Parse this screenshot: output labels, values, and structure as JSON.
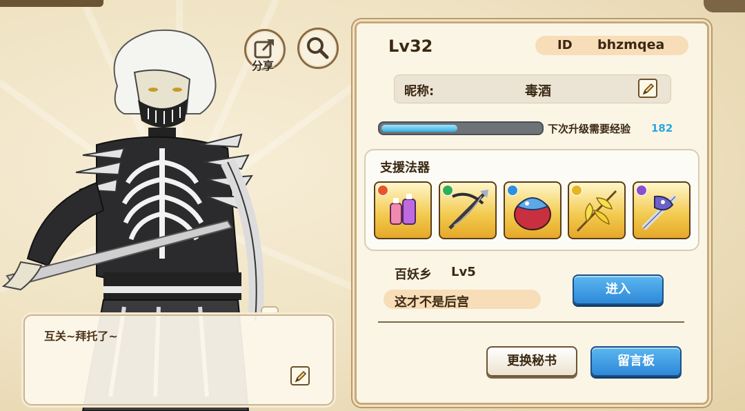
{
  "profile": {
    "level": "Lv32",
    "id_label": "ID",
    "id_value": "bhzmqea",
    "nickname_label": "昵称:",
    "nickname": "毒酒",
    "exp_label": "下次升级需要经验",
    "exp_value": "182",
    "exp_progress": 0.48
  },
  "support": {
    "title": "支援法器",
    "items": [
      {
        "name": "perfume-bottles-artifact",
        "element_color": "#e8552a"
      },
      {
        "name": "crossbow-artifact",
        "element_color": "#2fae5a"
      },
      {
        "name": "shark-shield-artifact",
        "element_color": "#2f8fe0"
      },
      {
        "name": "golden-feather-spear-artifact",
        "element_color": "#e8b420"
      },
      {
        "name": "dragon-sword-artifact",
        "element_color": "#8a4fd0"
      }
    ]
  },
  "guild": {
    "name": "百妖乡",
    "level": "Lv5",
    "motto": "这才不是后宫",
    "enter_label": "进入"
  },
  "buttons": {
    "share_label": "分享",
    "swap_secretary": "更换秘书",
    "message_board": "留言板"
  },
  "quote": {
    "text": "互关~拜托了~"
  },
  "colors": {
    "accent_blue": "#2f88d8",
    "exp_text": "#2aa7e0",
    "pill": "#f7ddb8"
  }
}
